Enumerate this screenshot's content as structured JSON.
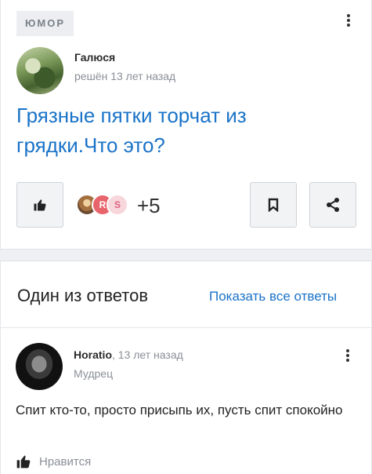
{
  "question": {
    "category": "ЮМОР",
    "author_name": "Галюся",
    "author_meta": "решён 13 лет назад",
    "title": "Грязные пятки торчат из грядки.Что это?",
    "likers": [
      "",
      "R",
      "S"
    ],
    "likes_more": "+5"
  },
  "answers": {
    "heading": "Один из ответов",
    "show_all": "Показать все ответы",
    "answer": {
      "author_name": "Horatio",
      "time": ", 13 лет назад",
      "rank": "Мудрец",
      "text": "Спит кто-то, просто присыпь их, пусть спит спокойно",
      "like_label": "Нравится"
    }
  },
  "icons": {
    "like": "thumbs-up-icon",
    "save": "bookmark-icon",
    "share": "share-icon",
    "menu": "more-vertical-icon"
  },
  "colors": {
    "link": "#1a73c8",
    "muted": "#8a8f97"
  }
}
